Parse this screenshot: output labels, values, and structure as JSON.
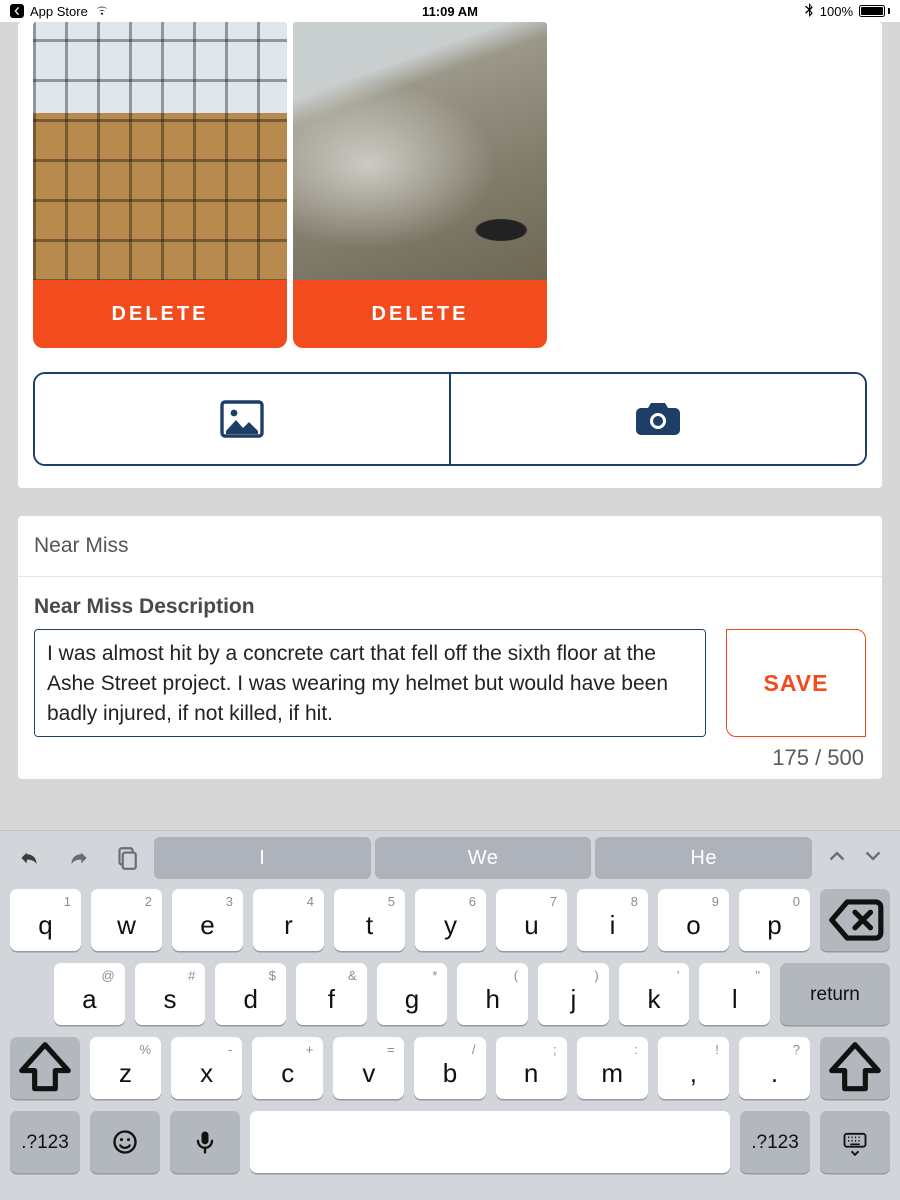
{
  "status": {
    "back_label": "App Store",
    "time": "11:09 AM",
    "battery": "100%"
  },
  "photos": {
    "delete_label": "DELETE"
  },
  "near_miss": {
    "section_title": "Near Miss",
    "field_label": "Near Miss Description",
    "value": "I was almost hit by a concrete cart that fell off the sixth floor at the Ashe Street project. I was wearing my helmet but would have been badly injured, if not killed, if hit.",
    "counter": "175 / 500",
    "save_label": "SAVE"
  },
  "keyboard": {
    "suggestions": [
      "I",
      "We",
      "He"
    ],
    "row1": [
      {
        "main": "q",
        "sub": "1"
      },
      {
        "main": "w",
        "sub": "2"
      },
      {
        "main": "e",
        "sub": "3"
      },
      {
        "main": "r",
        "sub": "4"
      },
      {
        "main": "t",
        "sub": "5"
      },
      {
        "main": "y",
        "sub": "6"
      },
      {
        "main": "u",
        "sub": "7"
      },
      {
        "main": "i",
        "sub": "8"
      },
      {
        "main": "o",
        "sub": "9"
      },
      {
        "main": "p",
        "sub": "0"
      }
    ],
    "row2": [
      {
        "main": "a",
        "sub": "@"
      },
      {
        "main": "s",
        "sub": "#"
      },
      {
        "main": "d",
        "sub": "$"
      },
      {
        "main": "f",
        "sub": "&"
      },
      {
        "main": "g",
        "sub": "*"
      },
      {
        "main": "h",
        "sub": "("
      },
      {
        "main": "j",
        "sub": ")"
      },
      {
        "main": "k",
        "sub": "'"
      },
      {
        "main": "l",
        "sub": "\""
      }
    ],
    "row3": [
      {
        "main": "z",
        "sub": "%"
      },
      {
        "main": "x",
        "sub": "-"
      },
      {
        "main": "c",
        "sub": "+"
      },
      {
        "main": "v",
        "sub": "="
      },
      {
        "main": "b",
        "sub": "/"
      },
      {
        "main": "n",
        "sub": ";"
      },
      {
        "main": "m",
        "sub": ":"
      },
      {
        "main": ",",
        "sub": "!"
      },
      {
        "main": ".",
        "sub": "?"
      }
    ],
    "numkey": ".?123",
    "return": "return"
  }
}
